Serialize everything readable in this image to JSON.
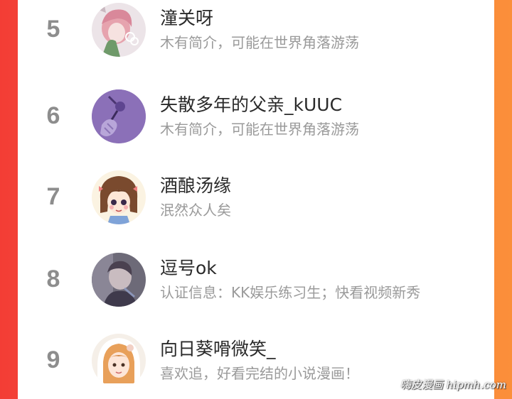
{
  "ranking": [
    {
      "rank": "5",
      "name": "潼关呀",
      "desc": "木有简介，可能在世界角落游荡",
      "avatar": "avatar-anime-girl-pink-hair"
    },
    {
      "rank": "6",
      "name": "失散多年的父亲_kUUC",
      "desc": "木有简介，可能在世界角落游荡",
      "avatar": "avatar-purple-hand-rose"
    },
    {
      "rank": "7",
      "name": "酒酿汤缘",
      "desc": "泯然众人矣",
      "avatar": "avatar-chibi-girl"
    },
    {
      "rank": "8",
      "name": "逗号ok",
      "desc": "认证信息：KK娱乐练习生；快看视频新秀",
      "avatar": "avatar-photo-person"
    },
    {
      "rank": "9",
      "name": "向日葵嗗微笑_",
      "desc": "喜欢追，好看完结的小说漫画！",
      "avatar": "avatar-girl-white-hood"
    }
  ],
  "watermark": "嗨皮漫画 hipmh.com"
}
